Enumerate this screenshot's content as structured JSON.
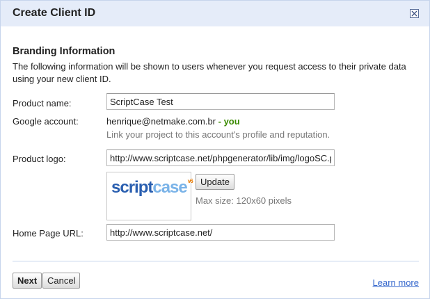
{
  "dialog": {
    "title": "Create Client ID"
  },
  "section": {
    "heading": "Branding Information",
    "description": "The following information will be shown to users whenever you request access to their private data using your new client ID."
  },
  "fields": {
    "product_name": {
      "label": "Product name:",
      "value": "ScriptCase Test"
    },
    "google_account": {
      "label": "Google account:",
      "email": "henrique@netmake.com.br",
      "separator": " - ",
      "you": "you",
      "hint": "Link your project to this account's profile and reputation."
    },
    "product_logo": {
      "label": "Product logo:",
      "value": "http://www.scriptcase.net/phpgenerator/lib/img/logoSC.p",
      "update_label": "Update",
      "max_size": "Max size: 120x60 pixels",
      "logo_text_primary": "script",
      "logo_text_secondary": "case",
      "logo_version": "v6"
    },
    "home_page": {
      "label": "Home Page URL:",
      "value": "http://www.scriptcase.net/"
    }
  },
  "footer": {
    "next_label": "Next",
    "cancel_label": "Cancel",
    "learn_more": "Learn more"
  },
  "colors": {
    "titlebar": "#e5ecf9",
    "link": "#3366cc",
    "you": "#3a8a00"
  },
  "icons": {
    "close": "close-icon"
  }
}
